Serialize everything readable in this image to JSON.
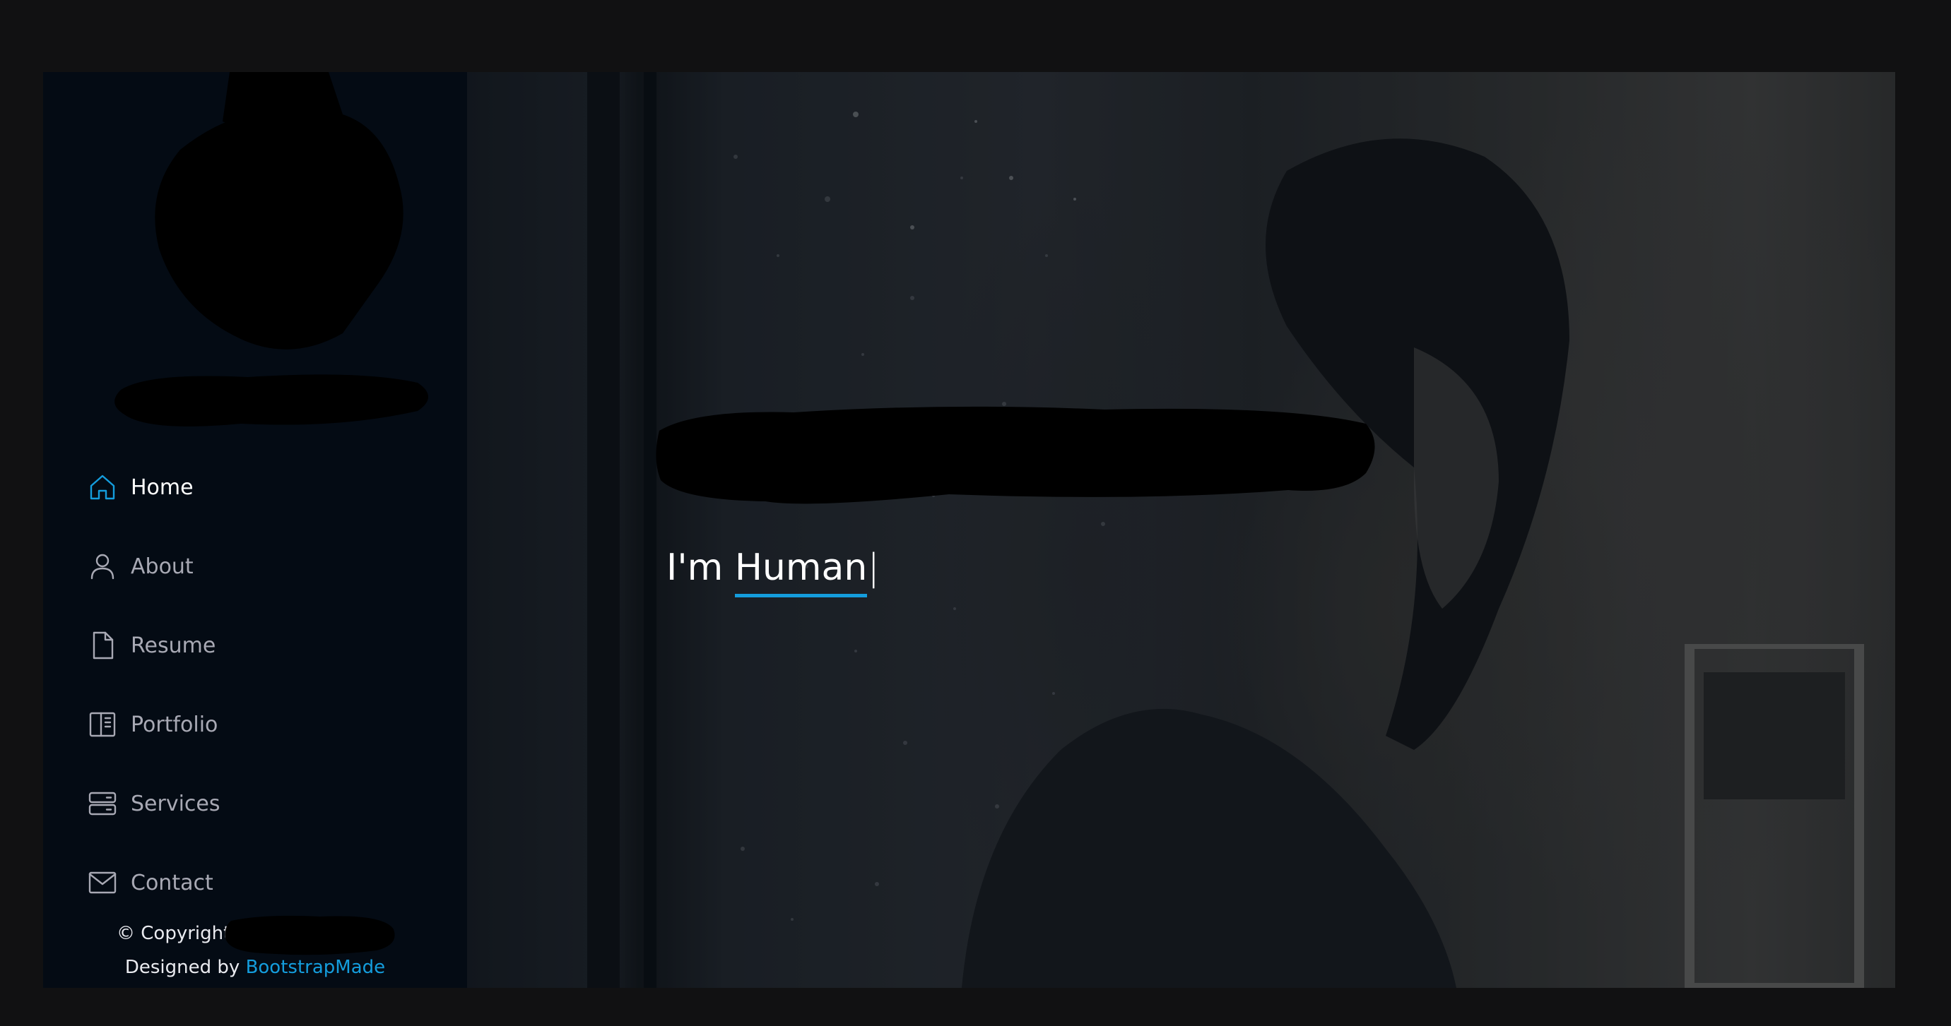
{
  "nav": {
    "items": [
      {
        "label": "Home",
        "icon": "house-icon",
        "active": true
      },
      {
        "label": "About",
        "icon": "person-icon",
        "active": false
      },
      {
        "label": "Resume",
        "icon": "file-icon",
        "active": false
      },
      {
        "label": "Portfolio",
        "icon": "book-half-icon",
        "active": false
      },
      {
        "label": "Services",
        "icon": "server-icon",
        "active": false
      },
      {
        "label": "Contact",
        "icon": "envelope-icon",
        "active": false
      }
    ]
  },
  "footer": {
    "copyright": "© Copyright",
    "designed_by": "Designed by",
    "designer_link": "BootstrapMade"
  },
  "hero": {
    "typed_prefix": "I'm",
    "typed_word": "Human",
    "cursor": "|"
  },
  "colors": {
    "accent": "#149ddd",
    "sidebar_bg": "#040b14",
    "nav_text": "#a8a9b4",
    "page_bg": "#111112"
  }
}
